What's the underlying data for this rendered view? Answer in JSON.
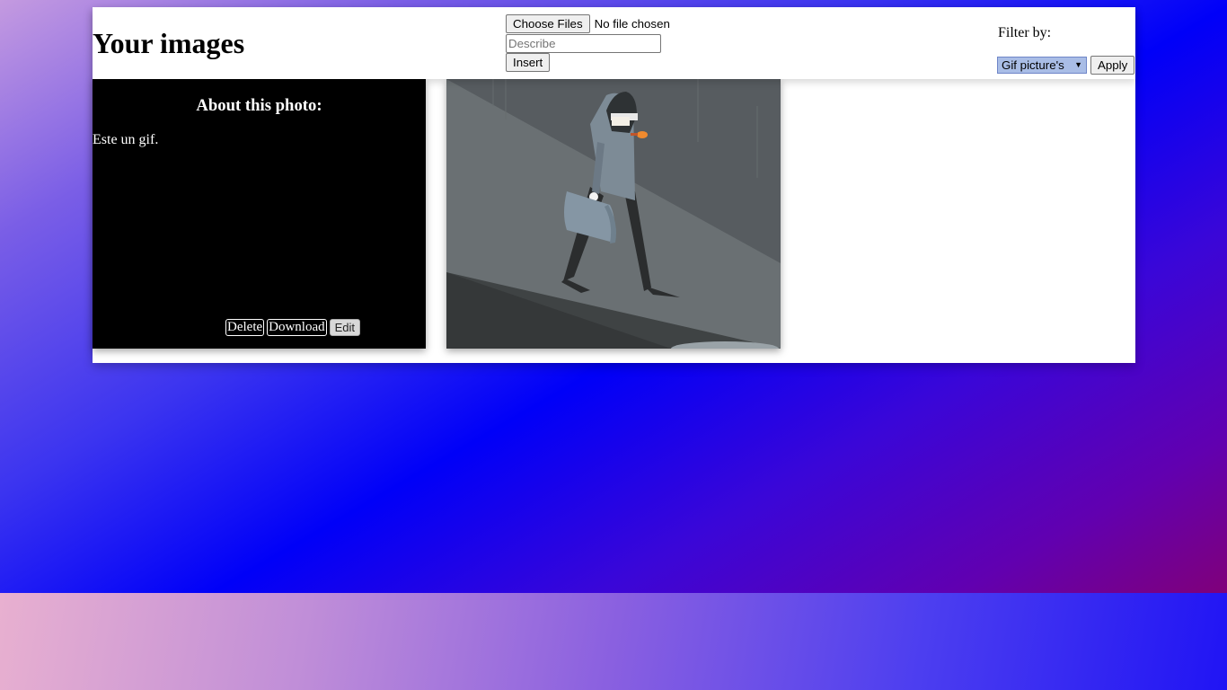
{
  "header": {
    "title": "Your images"
  },
  "upload": {
    "choose_files_label": "Choose Files",
    "file_status": "No file chosen",
    "describe_placeholder": "Describe",
    "describe_value": "",
    "insert_label": "Insert"
  },
  "filter": {
    "label": "Filter by:",
    "selected": "Gif picture's",
    "apply_label": "Apply"
  },
  "photos": [
    {
      "about_heading": "About this photo:",
      "description": "Este un gif.",
      "actions": {
        "delete": "Delete",
        "download": "Download",
        "edit": "Edit"
      },
      "image_icon": "animated-gif-thief-illustration"
    }
  ],
  "colors": {
    "info_card_bg": "#000000",
    "select_highlight": "#a9bde6"
  }
}
